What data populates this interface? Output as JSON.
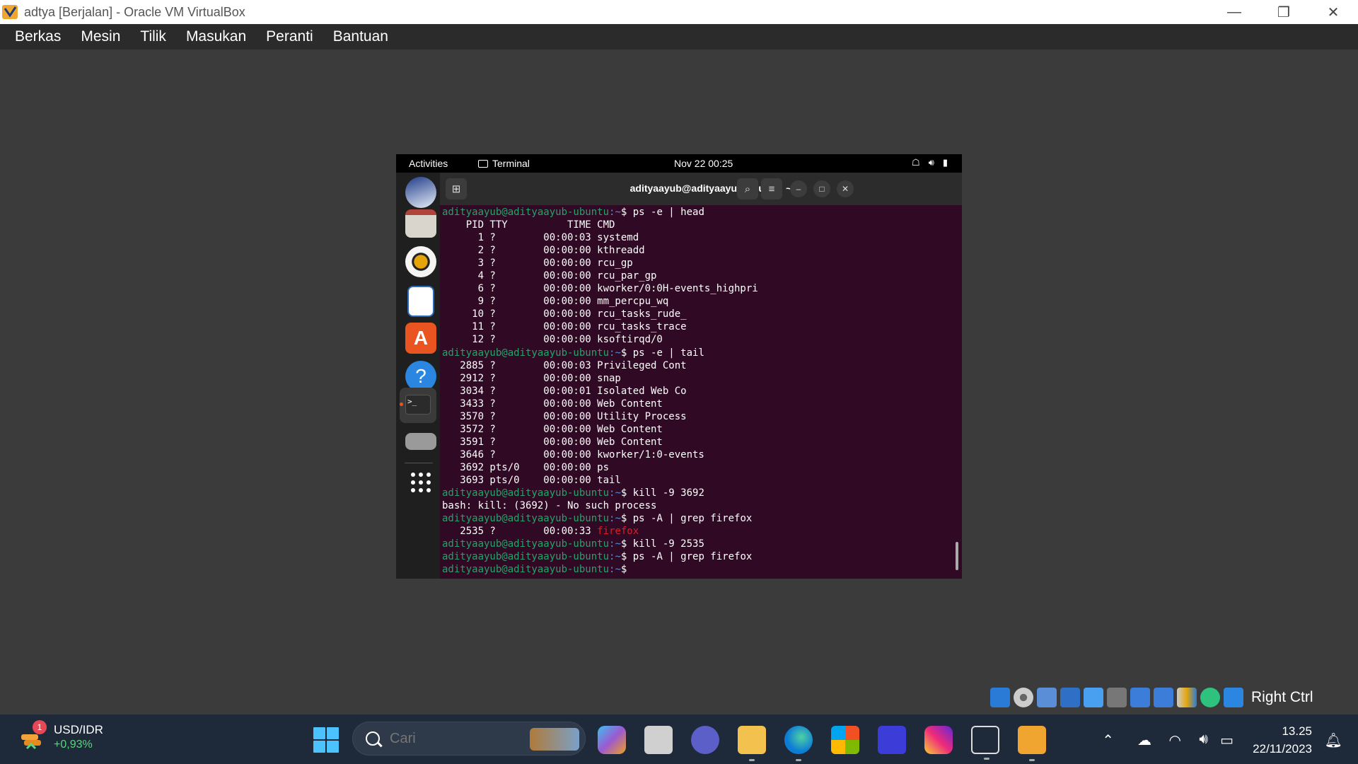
{
  "window": {
    "title": "adtya [Berjalan] - Oracle VM VirtualBox",
    "minimize": "—",
    "restore": "❐",
    "close": "✕"
  },
  "menubar": {
    "items": [
      "Berkas",
      "Mesin",
      "Tilik",
      "Masukan",
      "Peranti",
      "Bantuan"
    ]
  },
  "gnome": {
    "activities": "Activities",
    "app_name": "Terminal",
    "clock": "Nov 22  00:25"
  },
  "terminal": {
    "title": "adityaayub@adityaayub-ubuntu: ~",
    "prompt_user": "adityaayub@adityaayub-ubuntu",
    "prompt_path": ":~",
    "lines": [
      {
        "type": "cmd",
        "text": "$ ps -e | head"
      },
      {
        "type": "out",
        "text": "    PID TTY          TIME CMD"
      },
      {
        "type": "out",
        "text": "      1 ?        00:00:03 systemd"
      },
      {
        "type": "out",
        "text": "      2 ?        00:00:00 kthreadd"
      },
      {
        "type": "out",
        "text": "      3 ?        00:00:00 rcu_gp"
      },
      {
        "type": "out",
        "text": "      4 ?        00:00:00 rcu_par_gp"
      },
      {
        "type": "out",
        "text": "      6 ?        00:00:00 kworker/0:0H-events_highpri"
      },
      {
        "type": "out",
        "text": "      9 ?        00:00:00 mm_percpu_wq"
      },
      {
        "type": "out",
        "text": "     10 ?        00:00:00 rcu_tasks_rude_"
      },
      {
        "type": "out",
        "text": "     11 ?        00:00:00 rcu_tasks_trace"
      },
      {
        "type": "out",
        "text": "     12 ?        00:00:00 ksoftirqd/0"
      },
      {
        "type": "cmd",
        "text": "$ ps -e | tail"
      },
      {
        "type": "out",
        "text": "   2885 ?        00:00:03 Privileged Cont"
      },
      {
        "type": "out",
        "text": "   2912 ?        00:00:00 snap"
      },
      {
        "type": "out",
        "text": "   3034 ?        00:00:01 Isolated Web Co"
      },
      {
        "type": "out",
        "text": "   3433 ?        00:00:00 Web Content"
      },
      {
        "type": "out",
        "text": "   3570 ?        00:00:00 Utility Process"
      },
      {
        "type": "out",
        "text": "   3572 ?        00:00:00 Web Content"
      },
      {
        "type": "out",
        "text": "   3591 ?        00:00:00 Web Content"
      },
      {
        "type": "out",
        "text": "   3646 ?        00:00:00 kworker/1:0-events"
      },
      {
        "type": "out",
        "text": "   3692 pts/0    00:00:00 ps"
      },
      {
        "type": "out",
        "text": "   3693 pts/0    00:00:00 tail"
      },
      {
        "type": "cmd",
        "text": "$ kill -9 3692"
      },
      {
        "type": "out",
        "text": "bash: kill: (3692) - No such process"
      },
      {
        "type": "cmd",
        "text": "$ ps -A | grep firefox"
      },
      {
        "type": "hl",
        "text": "   2535 ?        00:00:33 ",
        "match": "firefox"
      },
      {
        "type": "cmd",
        "text": "$ kill -9 2535"
      },
      {
        "type": "cmd",
        "text": "$ ps -A | grep firefox"
      },
      {
        "type": "cmd",
        "text": "$ "
      }
    ]
  },
  "vbox_status": {
    "host_key": "Right Ctrl"
  },
  "taskbar": {
    "weather_badge": "1",
    "ticker": "USD/IDR",
    "change": "+0,93%",
    "search_placeholder": "Cari",
    "time": "13.25",
    "date": "22/11/2023"
  },
  "colors": {
    "terminal_bg": "#300a24",
    "prompt_user": "#26a269",
    "prompt_path": "#5c8ad6",
    "match": "#e01b24"
  }
}
